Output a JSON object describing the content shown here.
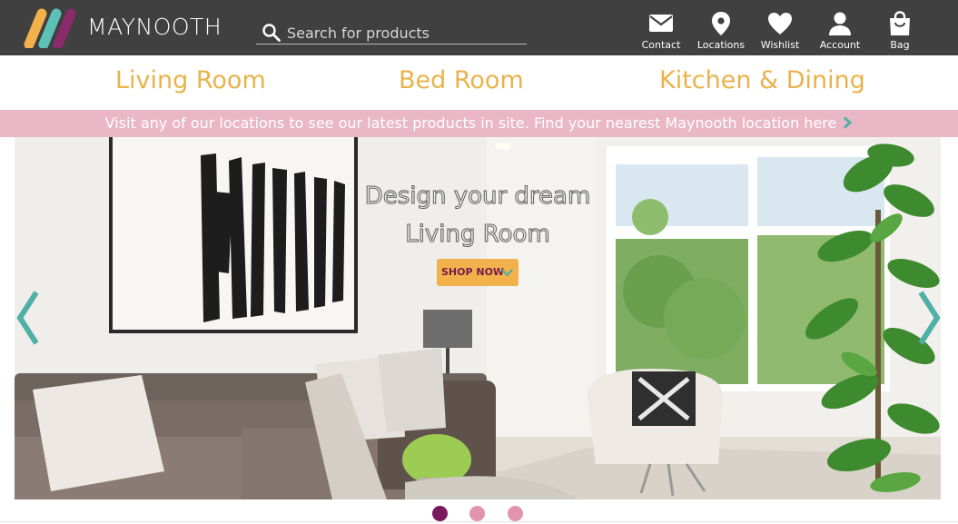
{
  "brand": {
    "name": "MAYNOOTH",
    "logo_colors": [
      "#f2b14a",
      "#5ec1b7",
      "#8a2c6c"
    ]
  },
  "search": {
    "placeholder": "Search for products",
    "value": ""
  },
  "header_nav": [
    {
      "label": "Contact",
      "icon": "envelope-icon"
    },
    {
      "label": "Locations",
      "icon": "map-pin-icon"
    },
    {
      "label": "Wishlist",
      "icon": "heart-icon"
    },
    {
      "label": "Account",
      "icon": "user-icon"
    },
    {
      "label": "Bag",
      "icon": "shopping-bag-icon"
    }
  ],
  "categories": [
    "Living Room",
    "Bed Room",
    "Kitchen & Dining"
  ],
  "promo": {
    "text": "Visit any of our locations to see our latest products in site. Find your nearest Maynooth location here",
    "arrow_icon": "chevron-right-icon"
  },
  "hero": {
    "title_line1": "Design your dream",
    "title_line2": "Living Room",
    "cta_label": "SHOP NOW",
    "cta_icon": "chevron-down-icon",
    "prev_icon": "chevron-left-icon",
    "next_icon": "chevron-right-icon"
  },
  "carousel": {
    "slide_count": 3,
    "active_index": 0
  },
  "colors": {
    "header_bg": "#404040",
    "category_text": "#eab24a",
    "promo_bg": "#e9b7c5",
    "accent_teal": "#4fb0a8",
    "dot_active": "#7a1a5c",
    "dot_inactive": "#e294ad",
    "cta_bg": "#f2b14a",
    "cta_text": "#7a1a4c"
  }
}
